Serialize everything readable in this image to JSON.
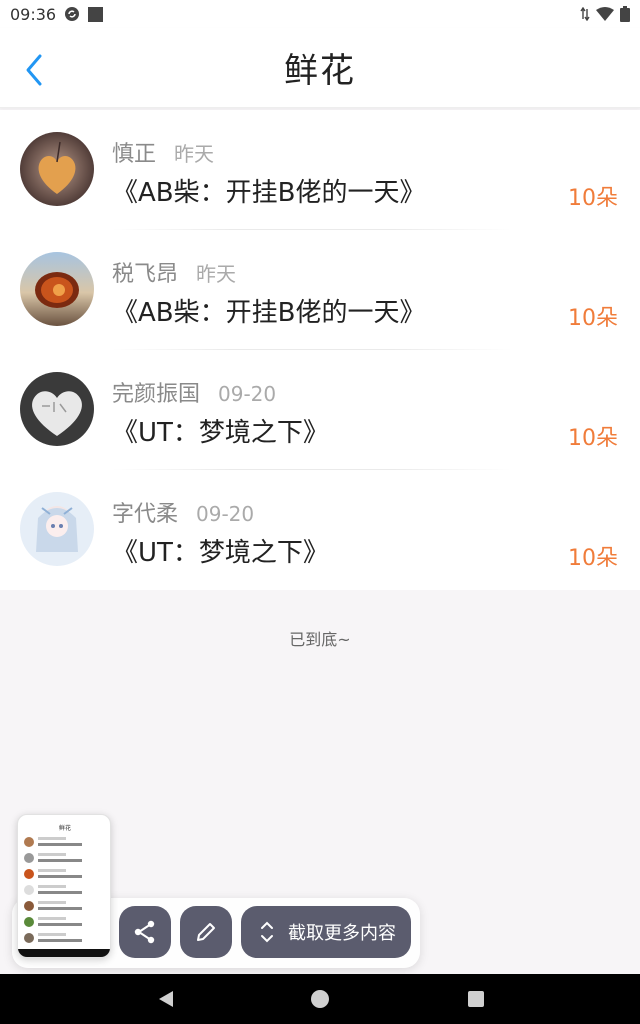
{
  "status_bar": {
    "time": "09:36",
    "icons_left": [
      "sync-icon",
      "square-icon"
    ],
    "icons_right": [
      "data-arrows-icon",
      "wifi-icon",
      "battery-icon"
    ]
  },
  "header": {
    "title": "鲜花",
    "back_icon": "chevron-left-icon",
    "accent_color": "#2196f3"
  },
  "list": {
    "items": [
      {
        "user": "慎正",
        "time": "昨天",
        "title": "《AB柴：开挂B佬的一天》",
        "count": "10朵",
        "avatar": "leaf-heart-photo"
      },
      {
        "user": "税飞昂",
        "time": "昨天",
        "title": "《AB柴：开挂B佬的一天》",
        "count": "10朵",
        "avatar": "shell-photo"
      },
      {
        "user": "完颜振国",
        "time": "09-20",
        "title": "《UT：梦境之下》",
        "count": "10朵",
        "avatar": "stone-heart-photo"
      },
      {
        "user": "字代柔",
        "time": "09-20",
        "title": "《UT：梦境之下》",
        "count": "10朵",
        "avatar": "anime-girl-photo"
      }
    ],
    "count_color": "#f07c3a"
  },
  "end_text": "已到底~",
  "screenshot_overlay": {
    "thumbnail_title": "鲜花",
    "more_label": "截取更多内容",
    "share_icon": "share-icon",
    "edit_icon": "pencil-icon",
    "expand_icon": "expand-vertical-icon"
  },
  "nav_bar": {
    "back_icon": "triangle-back-icon",
    "home_icon": "circle-home-icon",
    "recent_icon": "square-recent-icon"
  }
}
